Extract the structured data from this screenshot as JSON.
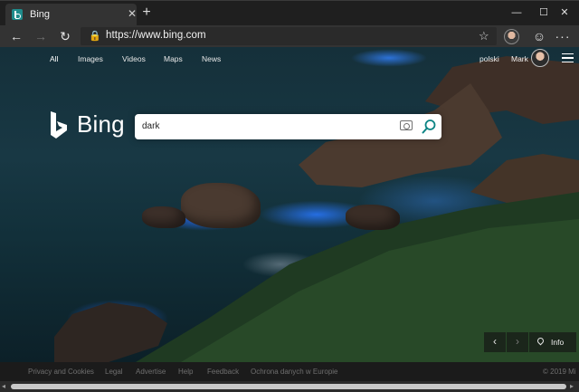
{
  "browser": {
    "tab": {
      "title": "Bing",
      "close_glyph": "✕"
    },
    "new_tab_glyph": "+",
    "window_controls": {
      "minimize": "—",
      "maximize": "☐",
      "close": "✕"
    },
    "toolbar": {
      "back_glyph": "←",
      "forward_glyph": "→",
      "refresh_glyph": "↻",
      "lock_glyph": "🔒",
      "url": "https://www.bing.com",
      "favorite_glyph": "☆",
      "feedback_glyph": "☺",
      "more_glyph": "···"
    }
  },
  "bing": {
    "nav": [
      "All",
      "Images",
      "Videos",
      "Maps",
      "News"
    ],
    "active_nav": "All",
    "language": "polski",
    "user_name": "Mark",
    "logo_text": "Bing",
    "search": {
      "value": "dark"
    },
    "carousel": {
      "prev_glyph": "‹",
      "next_glyph": "›",
      "info_label": "Info"
    },
    "footer": {
      "links": [
        "Privacy and Cookies",
        "Legal",
        "Advertise",
        "Help",
        "Feedback",
        "Ochrona danych w Europie"
      ],
      "copyright": "© 2019 Mi"
    },
    "accent_color": "#0c8484"
  },
  "scrollbar": {
    "left_glyph": "◂",
    "right_glyph": "▸"
  }
}
